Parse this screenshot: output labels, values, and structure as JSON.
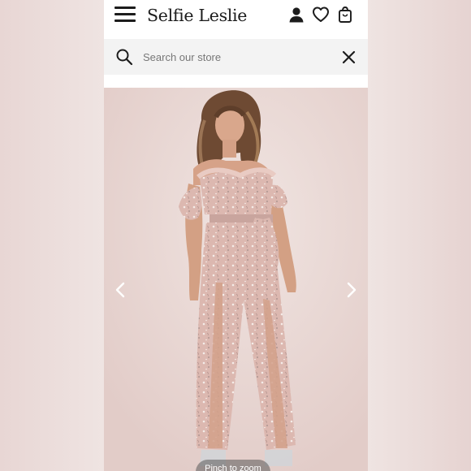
{
  "header": {
    "brand": "Selfie Leslie",
    "icons": [
      "menu-icon",
      "account-icon",
      "heart-icon",
      "bag-icon"
    ]
  },
  "search": {
    "placeholder": "Search our store",
    "value": ""
  },
  "gallery": {
    "image_description": "Model wearing a pink floral off-shoulder ruffle jumpsuit with tie waist and split wide legs",
    "hint": "Pinch to zoom"
  },
  "colors": {
    "header_bg": "#ffffff",
    "search_bg": "#f3f3f3",
    "text": "#1c1c1c",
    "photo_bg": "#ead9d6",
    "garment": "#dcb8b0"
  }
}
